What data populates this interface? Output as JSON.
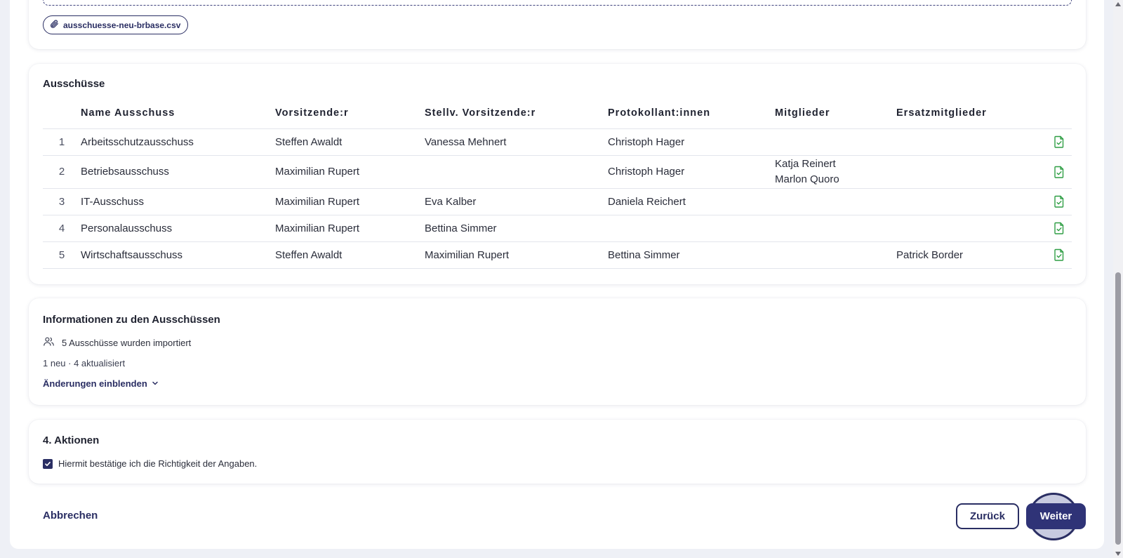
{
  "upload": {
    "file_name": "ausschuesse-neu-brbase.csv",
    "file_icon": "paperclip-icon"
  },
  "table_section": {
    "title": "Ausschüsse",
    "columns": [
      "Name Ausschuss",
      "Vorsitzende:r",
      "Stellv. Vorsitzende:r",
      "Protokollant:innen",
      "Mitglieder",
      "Ersatzmitglieder"
    ],
    "rows": [
      {
        "index": "1",
        "name": "Arbeitsschutzausschuss",
        "chair": "Steffen Awaldt",
        "vice_chair": "Vanessa Mehnert",
        "minutes": "Christoph Hager",
        "members": [],
        "substitutes": ""
      },
      {
        "index": "2",
        "name": "Betriebsausschuss",
        "chair": "Maximilian Rupert",
        "vice_chair": "",
        "minutes": "Christoph Hager",
        "members": [
          "Katja Reinert",
          "Marlon Quoro"
        ],
        "substitutes": ""
      },
      {
        "index": "3",
        "name": "IT-Ausschuss",
        "chair": "Maximilian Rupert",
        "vice_chair": "Eva Kalber",
        "minutes": "Daniela Reichert",
        "members": [],
        "substitutes": ""
      },
      {
        "index": "4",
        "name": "Personalausschuss",
        "chair": "Maximilian Rupert",
        "vice_chair": "Bettina Simmer",
        "minutes": "",
        "members": [],
        "substitutes": ""
      },
      {
        "index": "5",
        "name": "Wirtschaftsausschuss",
        "chair": "Steffen Awaldt",
        "vice_chair": "Maximilian Rupert",
        "minutes": "Bettina Simmer",
        "members": [],
        "substitutes": "Patrick Border"
      }
    ],
    "row_action_icon": "document-check-icon",
    "row_action_color": "#2f9e44"
  },
  "info_section": {
    "title": "Informationen zu den Ausschüssen",
    "import_text": "5 Ausschüsse wurden importiert",
    "import_icon": "users-icon",
    "summary": "1 neu · 4 aktualisiert",
    "toggle_label": "Änderungen einblenden",
    "toggle_icon": "chevron-down-icon"
  },
  "actions_section": {
    "title": "4. Aktionen",
    "confirm_label": "Hiermit bestätige ich die Richtigkeit der Angaben.",
    "confirm_checked": true
  },
  "footer": {
    "cancel_label": "Abbrechen",
    "back_label": "Zurück",
    "next_label": "Weiter"
  },
  "colors": {
    "primary": "#2f3377",
    "success": "#2f9e44"
  }
}
